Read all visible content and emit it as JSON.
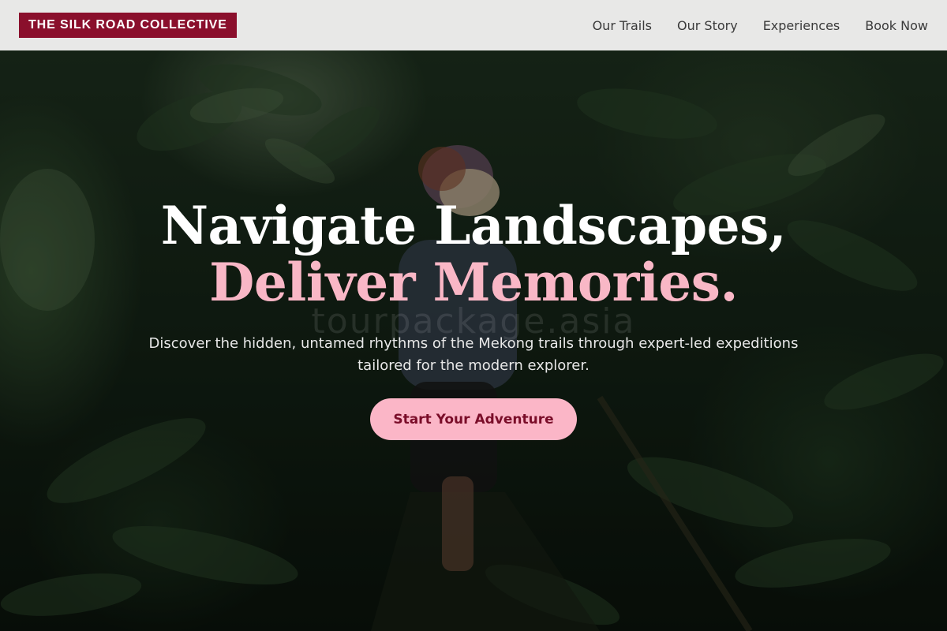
{
  "brand": {
    "name": "THE SILK ROAD COLLECTIVE"
  },
  "nav": {
    "items": [
      {
        "label": "Our Trails"
      },
      {
        "label": "Our Story"
      },
      {
        "label": "Experiences"
      },
      {
        "label": "Book Now"
      }
    ]
  },
  "hero": {
    "headline_line1": "Navigate Landscapes,",
    "headline_line2": "Deliver Memories.",
    "subtext": "Discover the hidden, untamed rhythms of the Mekong trails through expert-led expeditions tailored for the modern explorer.",
    "cta_label": "Start Your Adventure",
    "watermark": "tourpackage.asia"
  },
  "colors": {
    "header_bg": "#e8e8e7",
    "brand_bg": "#8a0f2c",
    "accent_pink": "#f9b7c6",
    "cta_text": "#7a0d29"
  }
}
